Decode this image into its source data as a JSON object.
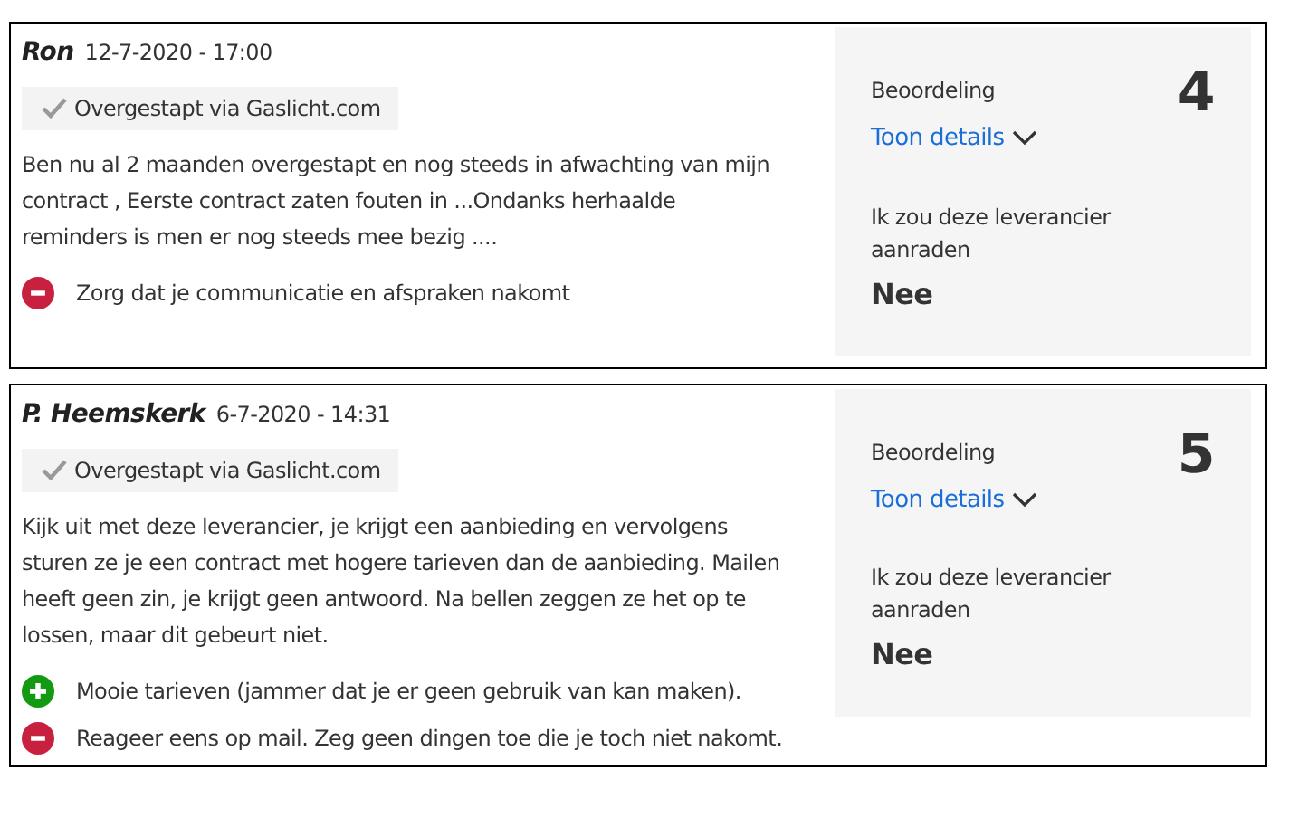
{
  "reviews": [
    {
      "author": "Ron",
      "date": "12-7-2020 - 17:00",
      "badge": "Overgestapt via Gaslicht.com",
      "text": "Ben nu al 2 maanden overgestapt en nog steeds in afwachting van mijn contract , Eerste contract zaten fouten in ...Ondanks herhaalde reminders is men er nog steeds mee bezig ....",
      "points": [
        {
          "kind": "con",
          "text": "Zorg dat je communicatie en afspraken nakomt"
        }
      ],
      "rating_label": "Beoordeling",
      "score": "4",
      "details_link": "Toon details",
      "recommend_label": "Ik zou deze leverancier aanraden",
      "recommend": "Nee"
    },
    {
      "author": "P. Heemskerk",
      "date": "6-7-2020 - 14:31",
      "badge": "Overgestapt via Gaslicht.com",
      "text": "Kijk uit met deze leverancier, je krijgt een aanbieding en vervolgens sturen ze je een contract met hogere tarieven dan de aanbieding. Mailen heeft geen zin, je krijgt geen antwoord. Na bellen zeggen ze het op te lossen, maar dit gebeurt niet.",
      "points": [
        {
          "kind": "pro",
          "text": "Mooie tarieven (jammer dat je er geen gebruik van kan maken)."
        },
        {
          "kind": "con",
          "text": "Reageer eens op mail. Zeg geen dingen toe die je toch niet nakomt."
        }
      ],
      "rating_label": "Beoordeling",
      "score": "5",
      "details_link": "Toon details",
      "recommend_label": "Ik zou deze leverancier aanraden",
      "recommend": "Nee"
    }
  ]
}
